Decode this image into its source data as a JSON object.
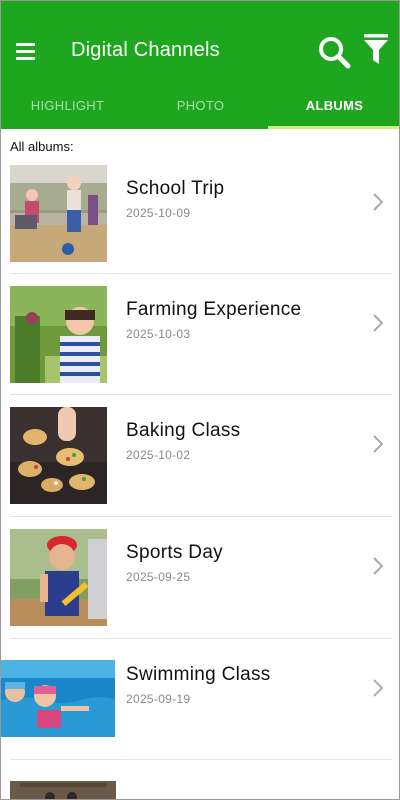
{
  "header": {
    "title": "Digital Channels",
    "menu_icon": "hamburger-menu-icon",
    "search_icon": "search-icon",
    "filter_icon": "filter-icon",
    "bg_color": "#1ea71e"
  },
  "tabs": [
    {
      "label": "HIGHLIGHT",
      "active": false
    },
    {
      "label": "PHOTO",
      "active": false
    },
    {
      "label": "ALBUMS",
      "active": true
    }
  ],
  "section_label": "All albums:",
  "albums": [
    {
      "name": "School Trip",
      "date": "2025-10-09"
    },
    {
      "name": "Farming Experience",
      "date": "2025-10-03"
    },
    {
      "name": "Baking Class",
      "date": "2025-10-02"
    },
    {
      "name": "Sports Day",
      "date": "2025-09-25"
    },
    {
      "name": "Swimming Class",
      "date": "2025-09-19"
    }
  ]
}
